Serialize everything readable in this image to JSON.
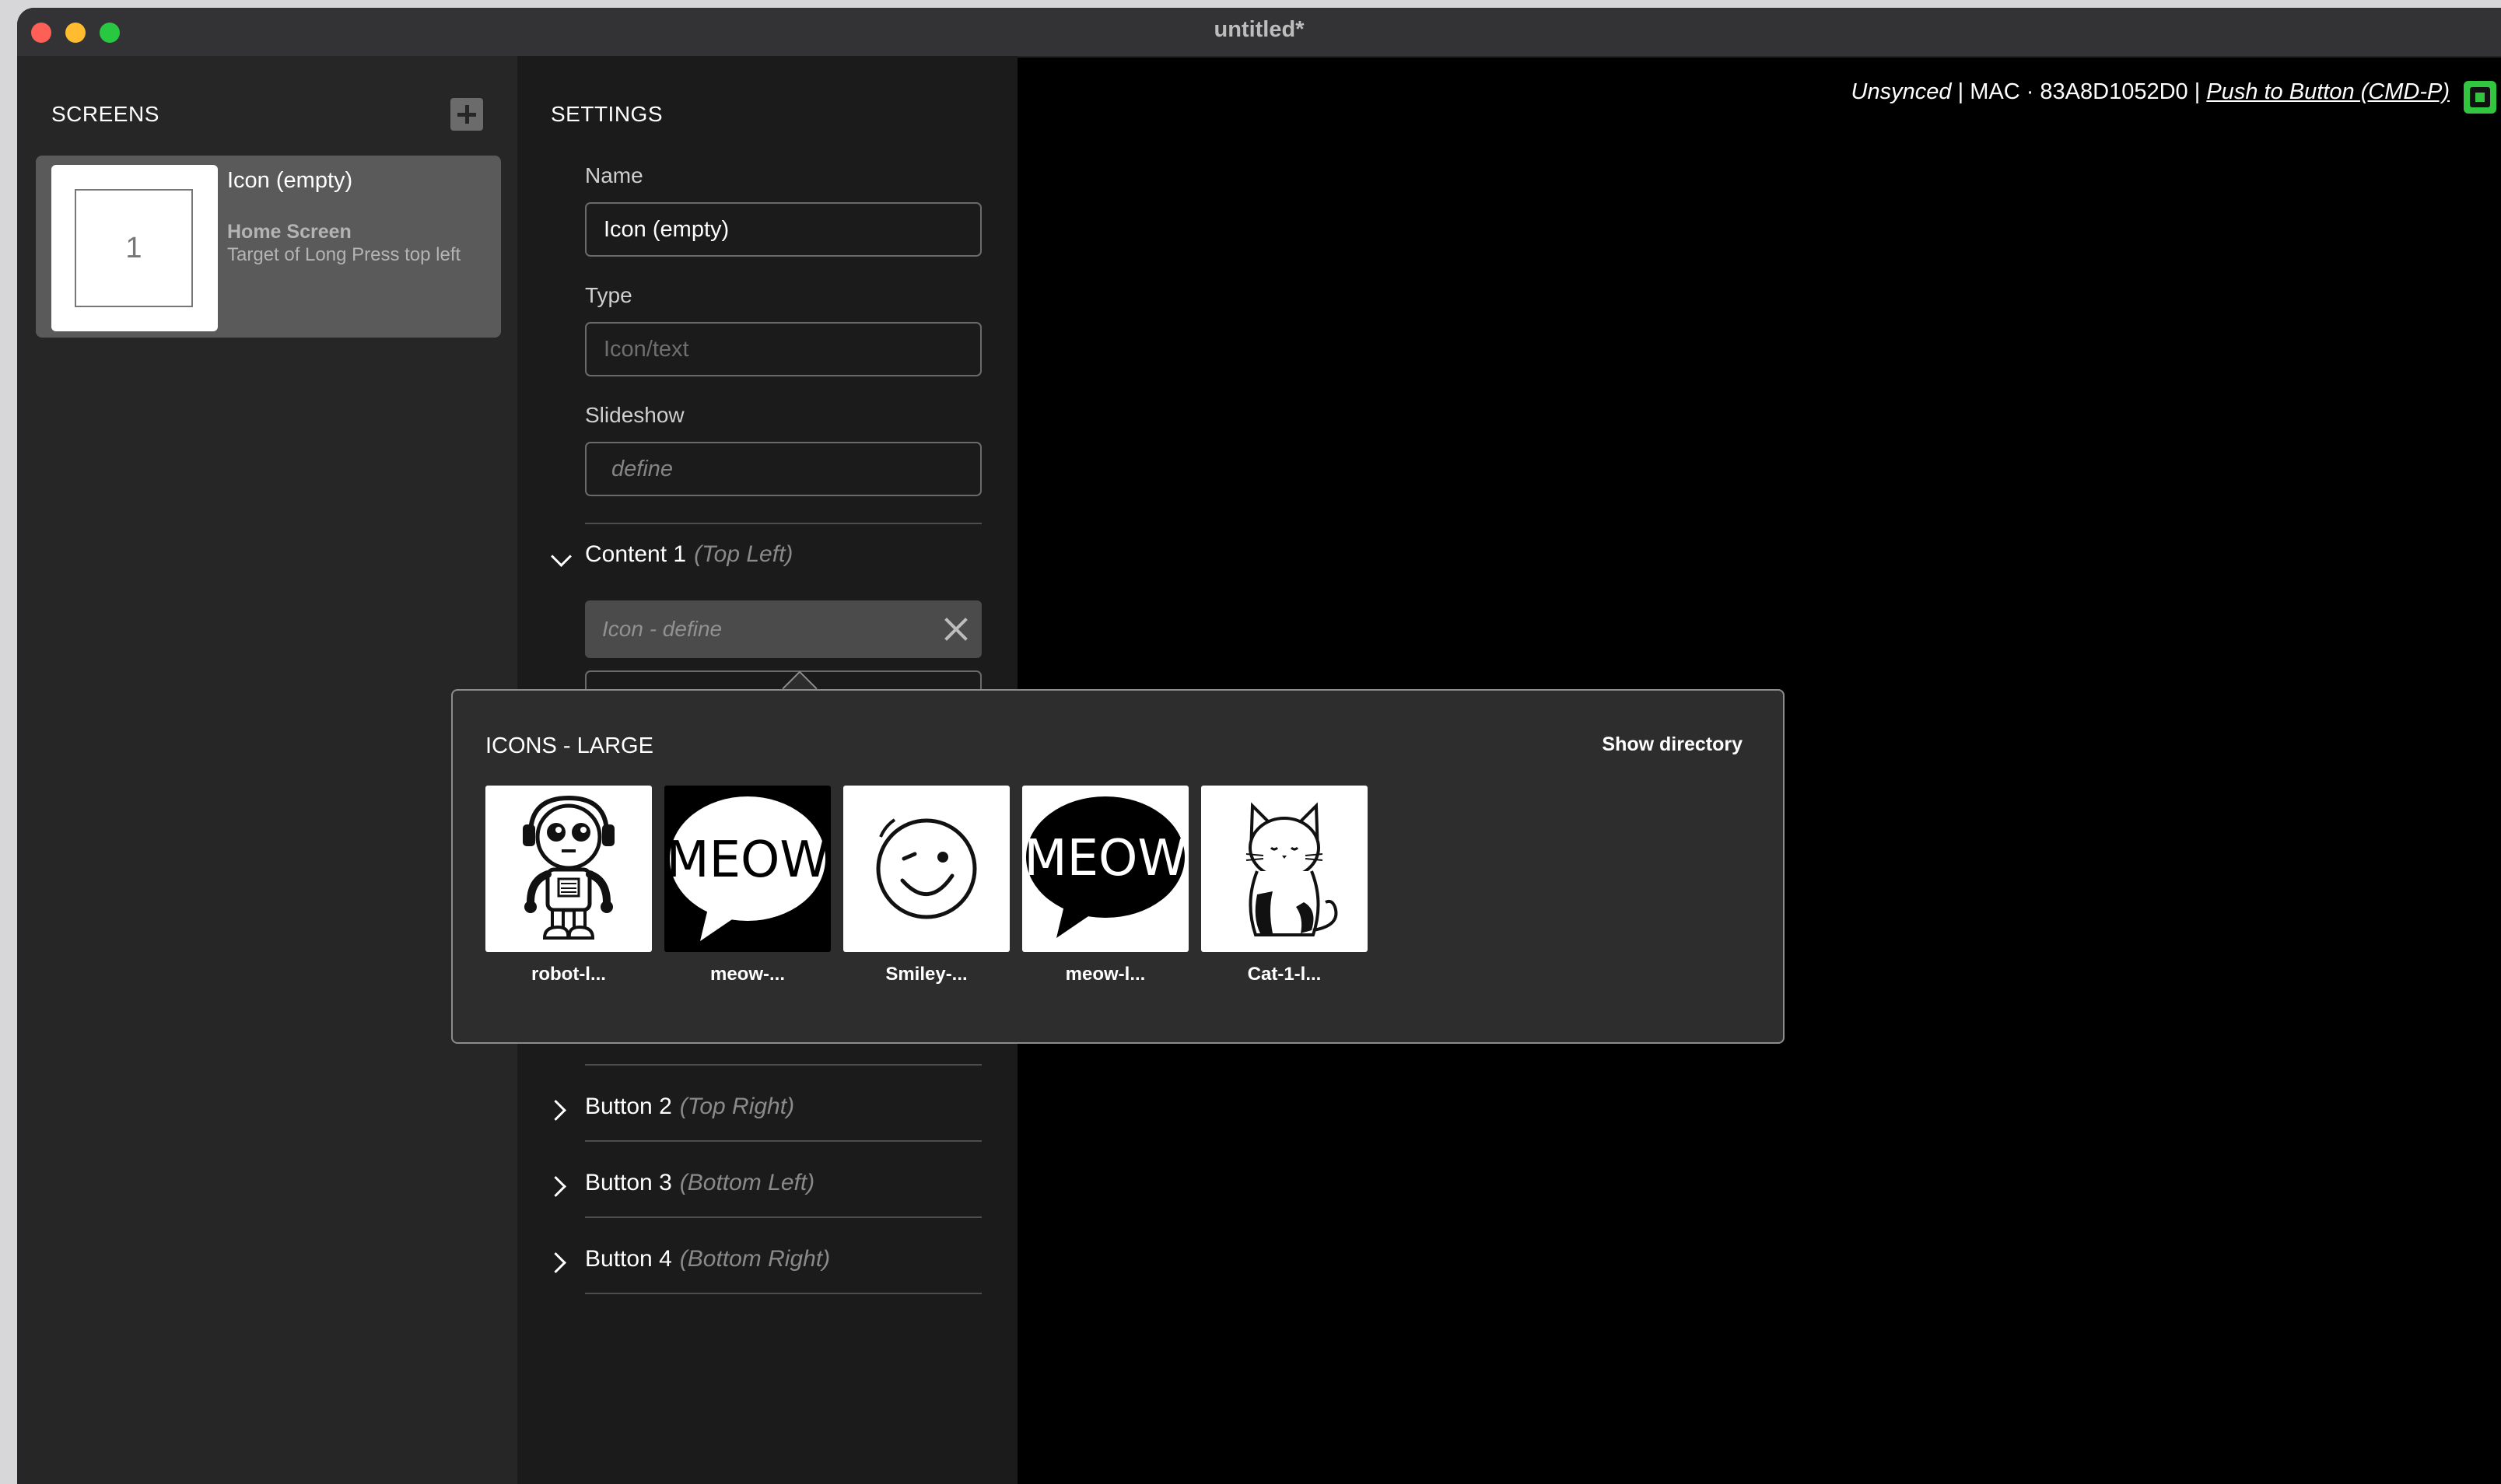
{
  "window": {
    "title": "untitled*"
  },
  "screens": {
    "heading": "SCREENS",
    "items": [
      {
        "thumb_number": "1",
        "title": "Icon (empty)",
        "subtitle": "Home Screen",
        "detail": "Target of Long Press top left"
      }
    ]
  },
  "settings": {
    "heading": "SETTINGS",
    "name": {
      "label": "Name",
      "value": "Icon (empty)"
    },
    "type": {
      "label": "Type",
      "placeholder": "Icon/text"
    },
    "slideshow": {
      "label": "Slideshow",
      "placeholder": "define"
    },
    "content1": {
      "title": "Content 1",
      "position": "(Top Left)",
      "icon_placeholder": "Icon - define"
    },
    "buttons": [
      {
        "title": "Button 2",
        "position": "(Top Right)"
      },
      {
        "title": "Button 3",
        "position": "(Bottom Left)"
      },
      {
        "title": "Button 4",
        "position": "(Bottom Right)"
      }
    ]
  },
  "status": {
    "sync": "Unsynced",
    "separator": "|",
    "mac": "MAC · 83A8D1052D0",
    "push_link": "Push to Button (CMD-P)"
  },
  "icon_picker": {
    "title": "ICONS - LARGE",
    "show_directory": "Show directory",
    "icons": [
      {
        "name": "robot-l...",
        "icon": "robot-icon",
        "background": "#ffffff"
      },
      {
        "name": "meow-...",
        "icon": "meow-bubble-icon",
        "background": "#000000",
        "bubble_text": "MEOW"
      },
      {
        "name": "Smiley-...",
        "icon": "winking-smiley-icon",
        "background": "#ffffff"
      },
      {
        "name": "meow-l...",
        "icon": "meow-bubble-icon",
        "background": "#ffffff",
        "bubble_text": "MEOW"
      },
      {
        "name": "Cat-1-l...",
        "icon": "cat-icon",
        "background": "#ffffff"
      }
    ]
  },
  "colors": {
    "close": "#fe5f57",
    "minimize": "#febc2e",
    "maximize": "#28c840",
    "status_icon": "#31c540"
  }
}
